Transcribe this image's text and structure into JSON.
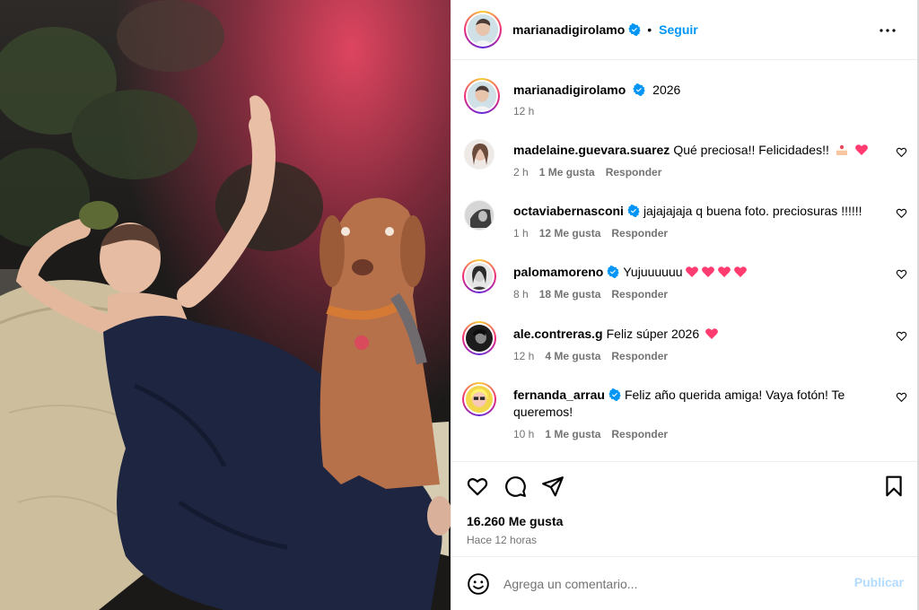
{
  "post": {
    "author": "marianadigirolamo",
    "follow_label": "Seguir",
    "separator": "•",
    "caption": {
      "username": "marianadigirolamo",
      "text": "2026",
      "time": "12 h"
    }
  },
  "comments": [
    {
      "username": "madelaine.guevara.suarez",
      "verified": false,
      "text": "Qué preciosa!! Felicidades!!",
      "emoji": [
        "cake",
        "heart"
      ],
      "time": "2 h",
      "likes": "1 Me gusta",
      "reply": "Responder"
    },
    {
      "username": "octaviabernasconi",
      "verified": true,
      "text": "jajajajaja q buena foto. preciosuras !!!!!!",
      "emoji": [],
      "time": "1 h",
      "likes": "12 Me gusta",
      "reply": "Responder"
    },
    {
      "username": "palomamoreno",
      "verified": true,
      "text": "Yujuuuuuu",
      "emoji": [
        "heart",
        "heart",
        "heart",
        "heart"
      ],
      "time": "8 h",
      "likes": "18 Me gusta",
      "reply": "Responder"
    },
    {
      "username": "ale.contreras.g",
      "verified": false,
      "text": "Feliz súper 2026",
      "emoji": [
        "heart"
      ],
      "time": "12 h",
      "likes": "4 Me gusta",
      "reply": "Responder"
    },
    {
      "username": "fernanda_arrau",
      "verified": true,
      "text": "Feliz año querida amiga! Vaya fotón! Te queremos!",
      "emoji": [],
      "time": "10 h",
      "likes": "1 Me gusta",
      "reply": "Responder"
    }
  ],
  "actions": {
    "icons": [
      "heart-icon",
      "comment-icon",
      "share-icon",
      "bookmark-icon"
    ],
    "likes_count": "16.260 Me gusta",
    "posted": "Hace 12 horas"
  },
  "compose": {
    "placeholder": "Agrega un comentario...",
    "publish_label": "Publicar"
  },
  "colors": {
    "accent": "#0095f6",
    "heart": "#ff3b70",
    "muted": "#737373",
    "publish_disabled": "#b3dbff"
  }
}
